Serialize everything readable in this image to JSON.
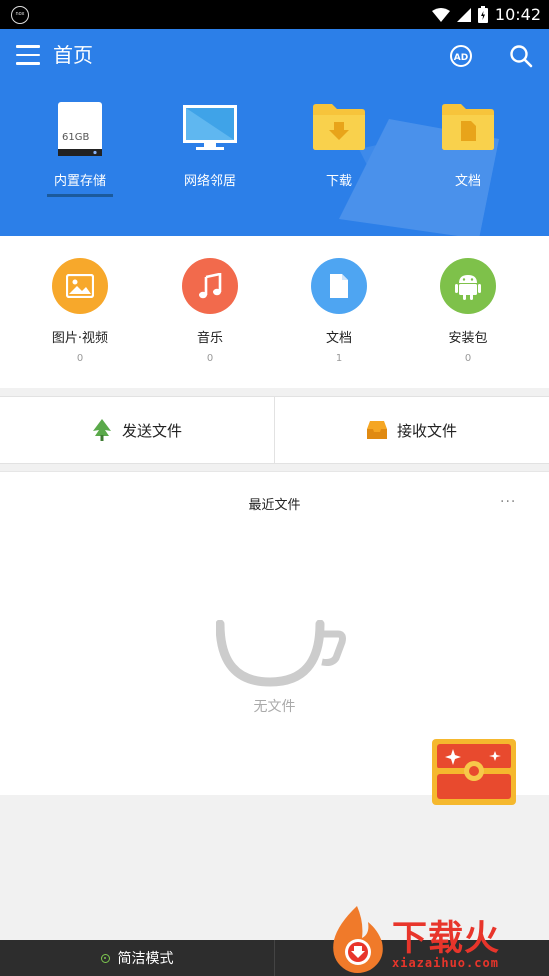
{
  "status_bar": {
    "time": "10:42",
    "left_icon": "nox-logo-icon"
  },
  "header": {
    "title": "首页",
    "bg_color": "#2c7fe8"
  },
  "locations": [
    {
      "label": "内置存储",
      "icon": "storage-icon",
      "capacity": "61GB",
      "selected": true
    },
    {
      "label": "网络邻居",
      "icon": "monitor-icon"
    },
    {
      "label": "下载",
      "icon": "download-folder-icon"
    },
    {
      "label": "文档",
      "icon": "document-folder-icon"
    }
  ],
  "categories": [
    {
      "label": "图片·视频",
      "count": "0",
      "icon": "image-icon",
      "color": "#f7a82b"
    },
    {
      "label": "音乐",
      "count": "0",
      "icon": "music-icon",
      "color": "#f26a4c"
    },
    {
      "label": "文档",
      "count": "1",
      "icon": "document-icon",
      "color": "#4ea5f2"
    },
    {
      "label": "安装包",
      "count": "0",
      "icon": "android-icon",
      "color": "#7ec14a"
    }
  ],
  "transfer": {
    "send_label": "发送文件",
    "receive_label": "接收文件"
  },
  "recent": {
    "title": "最近文件",
    "more": "···",
    "empty_text": "无文件"
  },
  "bottom_bar": {
    "simple_mode_label": "简洁模式"
  },
  "watermark": {
    "text": "下载火",
    "url": "xiazaihuo.com"
  }
}
